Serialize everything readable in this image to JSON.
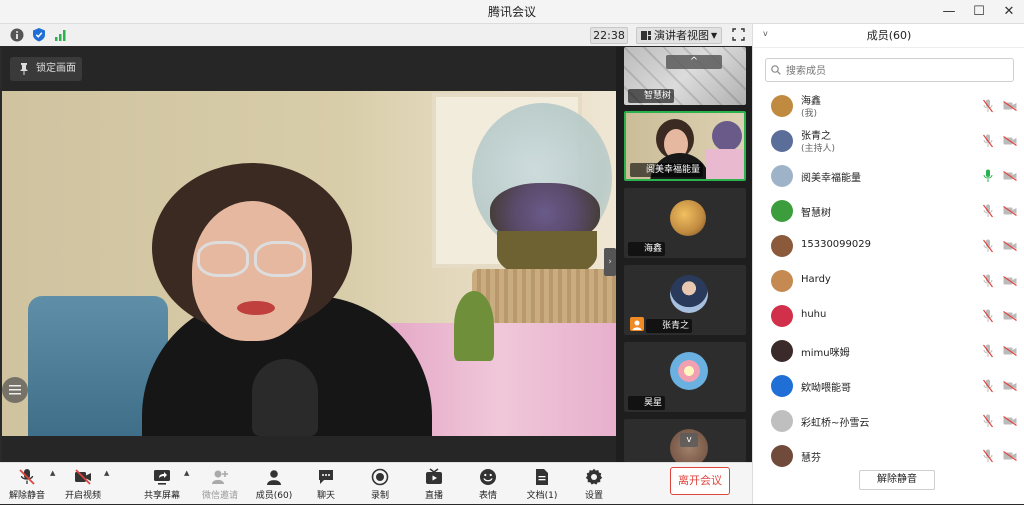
{
  "window": {
    "title": "腾讯会议"
  },
  "topbar": {
    "time": "22:38",
    "view_label": "演讲者视图"
  },
  "main": {
    "pin_label": "锁定画面"
  },
  "thumbs": [
    {
      "name": "智慧树"
    },
    {
      "name": "阅美幸福能量"
    },
    {
      "name": "海鑫"
    },
    {
      "name": "张青之"
    },
    {
      "name": "昊星"
    }
  ],
  "toolbar": {
    "unmute": "解除静音",
    "video": "开启视频",
    "share": "共享屏幕",
    "wechat_invite": "微信邀请",
    "members": "成员(60)",
    "chat": "聊天",
    "record": "录制",
    "live": "直播",
    "emoji": "表情",
    "docs": "文档(1)",
    "settings": "设置",
    "leave": "离开会议"
  },
  "panel": {
    "title": "成员(60)",
    "search_placeholder": "搜索成员",
    "members": [
      {
        "name": "海鑫",
        "sub": "(我)",
        "color": "#c08a40"
      },
      {
        "name": "张青之",
        "sub": "(主持人)",
        "color": "#5a6e99"
      },
      {
        "name": "阅美幸福能量",
        "sub": "",
        "color": "#9fb3c8"
      },
      {
        "name": "智慧树",
        "sub": "",
        "color": "#3b9d3b"
      },
      {
        "name": "15330099029",
        "sub": "",
        "color": "#8a5a3a"
      },
      {
        "name": "Hardy",
        "sub": "",
        "color": "#c48a52"
      },
      {
        "name": "huhu",
        "sub": "",
        "color": "#d0304a"
      },
      {
        "name": "mimu咪姆",
        "sub": "",
        "color": "#3a2a2a"
      },
      {
        "name": "欸呦喂能哥",
        "sub": "",
        "color": "#1f6fd6"
      },
      {
        "name": "彩虹桥~孙雪云",
        "sub": "",
        "color": "#bfbfbf"
      },
      {
        "name": "慧芬",
        "sub": "",
        "color": "#704a3a"
      }
    ],
    "unmute_all": "解除静音"
  }
}
